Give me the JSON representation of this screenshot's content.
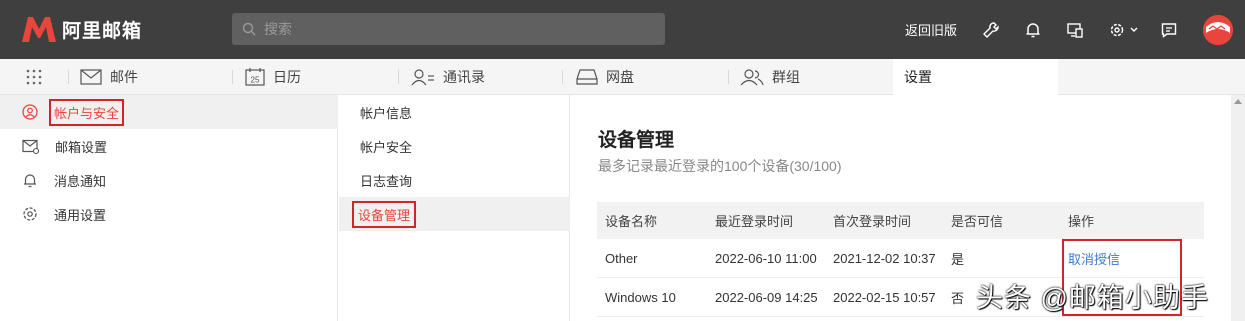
{
  "app": {
    "logo_text": "阿里邮箱",
    "brand_color": "#e8453c"
  },
  "search": {
    "placeholder": "搜索"
  },
  "topbar": {
    "back_link": "返回旧版"
  },
  "nav": {
    "items": [
      {
        "label": "邮件",
        "icon": "mail-icon"
      },
      {
        "label": "日历",
        "icon": "calendar-icon",
        "icon_text": "25"
      },
      {
        "label": "通讯录",
        "icon": "contacts-icon"
      },
      {
        "label": "网盘",
        "icon": "drive-icon"
      },
      {
        "label": "群组",
        "icon": "group-icon"
      },
      {
        "label": "设置",
        "icon": "",
        "active": true
      }
    ]
  },
  "sidebar": {
    "items": [
      {
        "label": "帐户与安全",
        "icon": "user-circle-icon",
        "active": true
      },
      {
        "label": "邮箱设置",
        "icon": "mail-settings-icon"
      },
      {
        "label": "消息通知",
        "icon": "bell-icon"
      },
      {
        "label": "通用设置",
        "icon": "gear-icon"
      }
    ]
  },
  "submenu": {
    "items": [
      {
        "label": "帐户信息"
      },
      {
        "label": "帐户安全"
      },
      {
        "label": "日志查询"
      },
      {
        "label": "设备管理",
        "active": true
      }
    ]
  },
  "main": {
    "title": "设备管理",
    "subtitle": "最多记录最近登录的100个设备(30/100)",
    "table": {
      "headers": [
        "设备名称",
        "最近登录时间",
        "首次登录时间",
        "是否可信",
        "操作"
      ],
      "rows": [
        [
          "Other",
          "2022-06-10 11:00",
          "2021-12-02 10:37",
          "是",
          "取消授信"
        ],
        [
          "Windows 10",
          "2022-06-09 14:25",
          "2022-02-15 10:57",
          "否",
          ""
        ]
      ]
    }
  },
  "watermark": "头条 @邮箱小助手"
}
